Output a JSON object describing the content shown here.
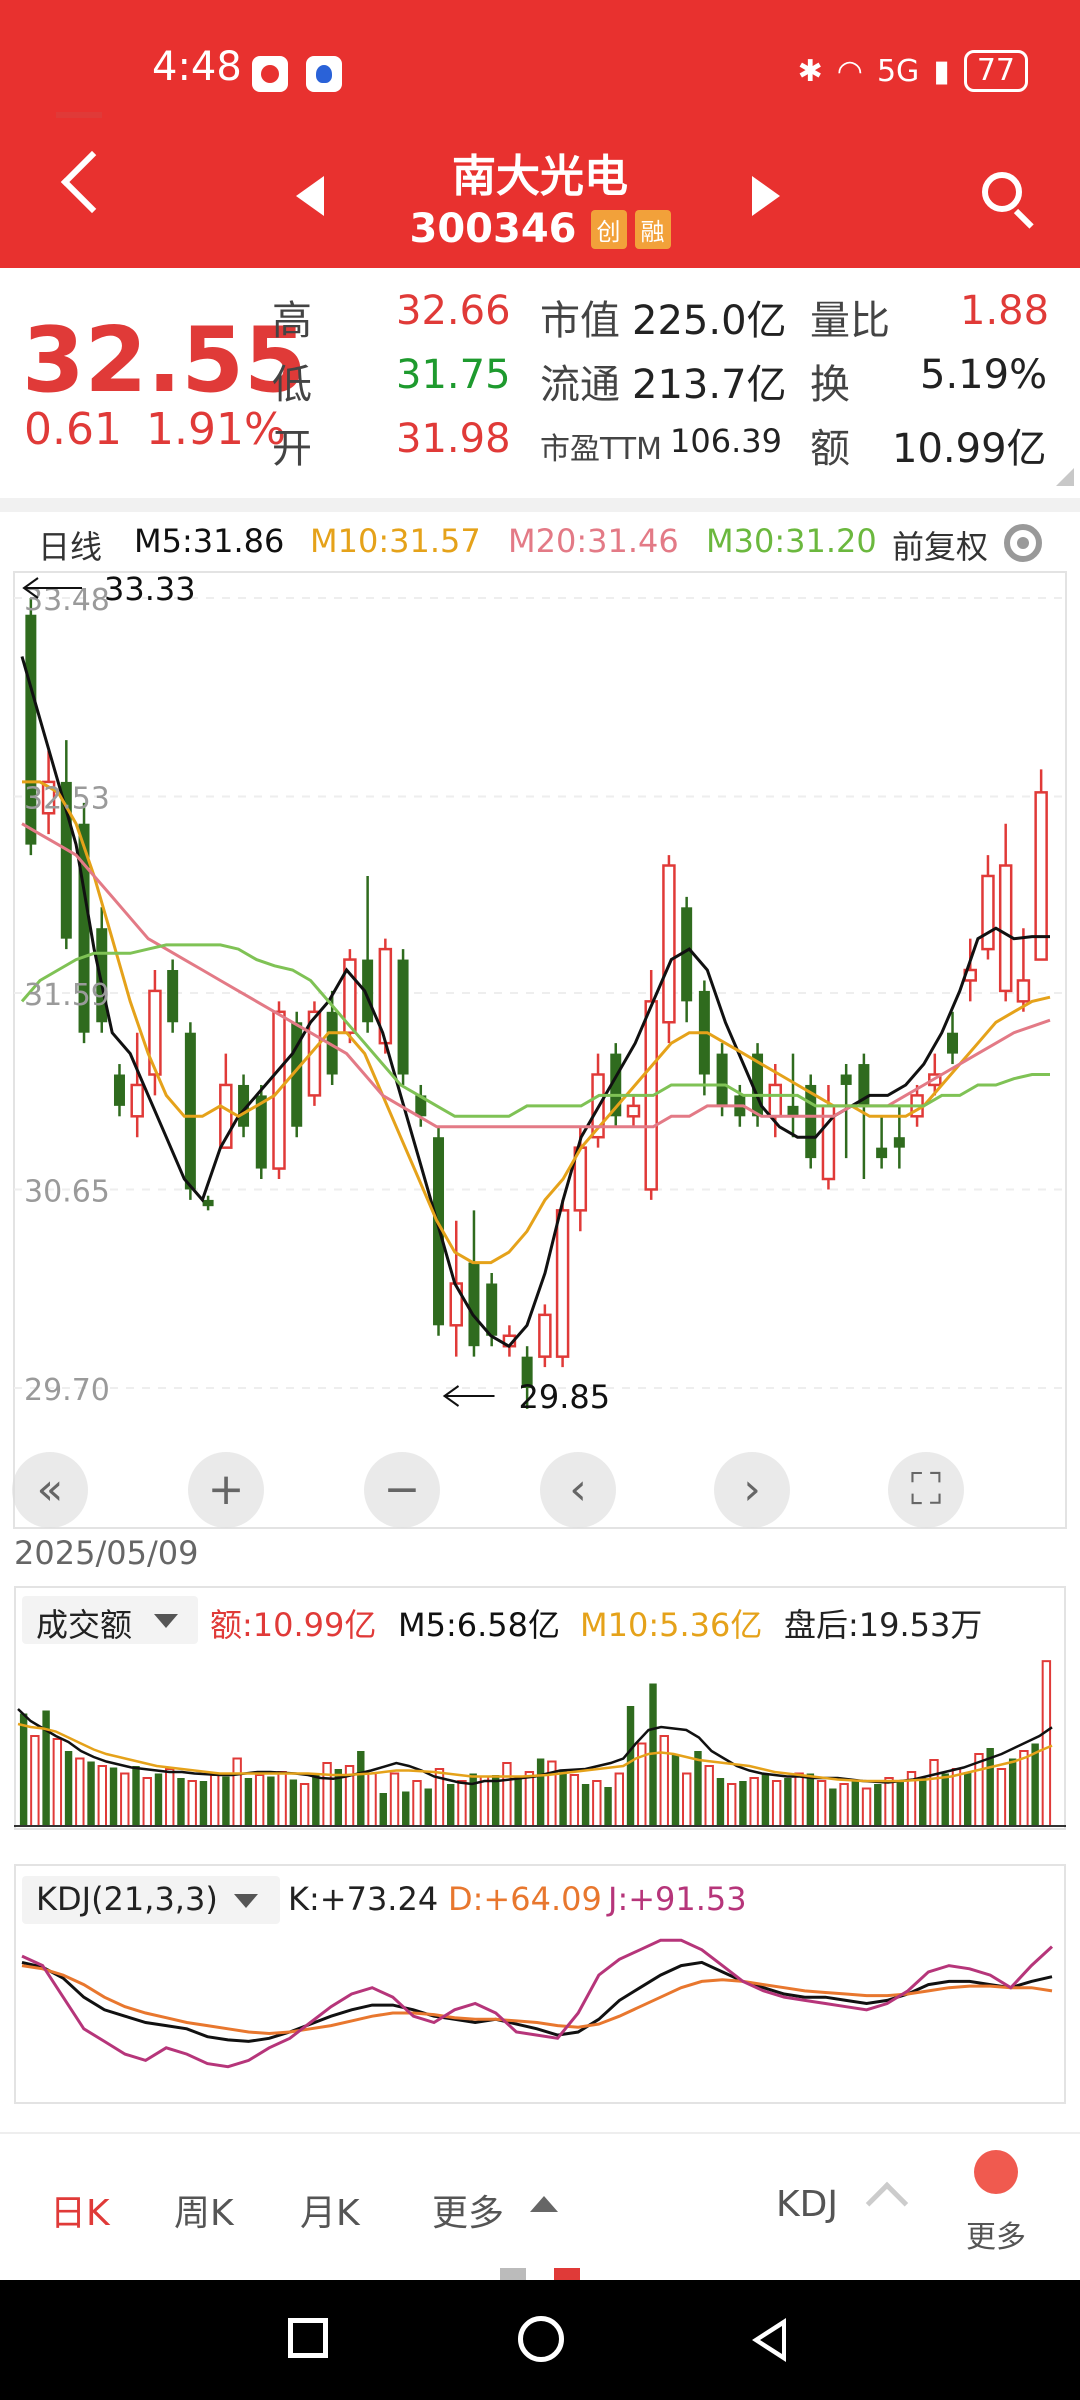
{
  "status_bar": {
    "time": "4:48",
    "signal": "5G",
    "battery": "77"
  },
  "header": {
    "title": "南大光电",
    "code": "300346",
    "tags": [
      "创",
      "融"
    ]
  },
  "quote": {
    "price": "32.55",
    "change": "0.61",
    "change_pct": "1.91%",
    "high_label": "高",
    "high": "32.66",
    "low_label": "低",
    "low": "31.75",
    "open_label": "开",
    "open": "31.98",
    "mcap_label": "市值",
    "mcap": "225.0亿",
    "float_label": "流通",
    "float": "213.7亿",
    "pe_label": "市盈TTM",
    "pe": "106.39",
    "vol_ratio_label": "量比",
    "vol_ratio": "1.88",
    "turnover_label": "换",
    "turnover": "5.19%",
    "amount_label": "额",
    "amount": "10.99亿"
  },
  "ma_legend": {
    "period": "日线",
    "m5": "M5:31.86",
    "m10": "M10:31.57",
    "m20": "M20:31.46",
    "m30": "M30:31.20",
    "adjust": "前复权"
  },
  "colors": {
    "up": "#e03a38",
    "down": "#2f6b1e",
    "m5": "#111111",
    "m10": "#e5a21a",
    "m20": "#e37a86",
    "m30": "#7fc255",
    "header": "#e8312f"
  },
  "chart_data": [
    {
      "type": "candlestick",
      "title": "日线",
      "y_ticks": [
        "33.48",
        "32.53",
        "31.59",
        "30.65",
        "29.70"
      ],
      "ylim": [
        29.7,
        33.48
      ],
      "annotations": {
        "max": "33.33",
        "min": "29.85"
      },
      "first_date": "2025/05/09",
      "candles": [
        {
          "o": 33.4,
          "c": 32.3,
          "h": 33.48,
          "l": 32.25
        },
        {
          "o": 32.45,
          "c": 32.6,
          "h": 32.75,
          "l": 32.35
        },
        {
          "o": 32.6,
          "c": 31.85,
          "h": 32.8,
          "l": 31.8
        },
        {
          "o": 32.4,
          "c": 31.4,
          "h": 32.5,
          "l": 31.35
        },
        {
          "o": 31.9,
          "c": 31.45,
          "h": 32.0,
          "l": 31.4
        },
        {
          "o": 31.2,
          "c": 31.05,
          "h": 31.25,
          "l": 31.0
        },
        {
          "o": 31.0,
          "c": 31.15,
          "h": 31.4,
          "l": 30.9
        },
        {
          "o": 31.2,
          "c": 31.6,
          "h": 31.7,
          "l": 31.1
        },
        {
          "o": 31.7,
          "c": 31.45,
          "h": 31.75,
          "l": 31.4
        },
        {
          "o": 31.4,
          "c": 30.65,
          "h": 31.45,
          "l": 30.6
        },
        {
          "o": 30.6,
          "c": 30.57,
          "h": 30.62,
          "l": 30.55
        },
        {
          "o": 30.85,
          "c": 31.15,
          "h": 31.3,
          "l": 30.85
        },
        {
          "o": 31.15,
          "c": 30.95,
          "h": 31.2,
          "l": 30.9
        },
        {
          "o": 31.1,
          "c": 30.75,
          "h": 31.15,
          "l": 30.7
        },
        {
          "o": 30.75,
          "c": 31.5,
          "h": 31.55,
          "l": 30.7
        },
        {
          "o": 31.45,
          "c": 30.95,
          "h": 31.5,
          "l": 30.9
        },
        {
          "o": 31.1,
          "c": 31.5,
          "h": 31.55,
          "l": 31.05
        },
        {
          "o": 31.5,
          "c": 31.2,
          "h": 31.6,
          "l": 31.15
        },
        {
          "o": 31.4,
          "c": 31.75,
          "h": 31.8,
          "l": 31.35
        },
        {
          "o": 31.75,
          "c": 31.45,
          "h": 32.15,
          "l": 31.4
        },
        {
          "o": 31.35,
          "c": 31.8,
          "h": 31.85,
          "l": 31.3
        },
        {
          "o": 31.75,
          "c": 31.2,
          "h": 31.8,
          "l": 31.15
        },
        {
          "o": 31.1,
          "c": 31.0,
          "h": 31.15,
          "l": 30.95
        },
        {
          "o": 30.9,
          "c": 30.0,
          "h": 30.95,
          "l": 29.95
        },
        {
          "o": 30.0,
          "c": 30.2,
          "h": 30.5,
          "l": 29.85
        },
        {
          "o": 30.3,
          "c": 29.9,
          "h": 30.55,
          "l": 29.85
        },
        {
          "o": 30.2,
          "c": 29.95,
          "h": 30.25,
          "l": 29.9
        },
        {
          "o": 29.9,
          "c": 29.95,
          "h": 30.0,
          "l": 29.85
        },
        {
          "o": 29.85,
          "c": 29.7,
          "h": 29.9,
          "l": 29.6
        },
        {
          "o": 29.85,
          "c": 30.05,
          "h": 30.1,
          "l": 29.8
        },
        {
          "o": 29.85,
          "c": 30.55,
          "h": 30.6,
          "l": 29.8
        },
        {
          "o": 30.55,
          "c": 30.85,
          "h": 30.95,
          "l": 30.45
        },
        {
          "o": 30.9,
          "c": 31.2,
          "h": 31.3,
          "l": 30.85
        },
        {
          "o": 31.3,
          "c": 31.0,
          "h": 31.35,
          "l": 30.95
        },
        {
          "o": 31.0,
          "c": 31.05,
          "h": 31.1,
          "l": 30.95
        },
        {
          "o": 30.65,
          "c": 31.55,
          "h": 31.7,
          "l": 30.6
        },
        {
          "o": 31.45,
          "c": 32.2,
          "h": 32.25,
          "l": 31.35
        },
        {
          "o": 32.0,
          "c": 31.55,
          "h": 32.05,
          "l": 31.45
        },
        {
          "o": 31.6,
          "c": 31.2,
          "h": 31.65,
          "l": 31.1
        },
        {
          "o": 31.3,
          "c": 31.05,
          "h": 31.35,
          "l": 31.0
        },
        {
          "o": 31.1,
          "c": 31.0,
          "h": 31.15,
          "l": 30.95
        },
        {
          "o": 31.3,
          "c": 31.0,
          "h": 31.35,
          "l": 30.95
        },
        {
          "o": 31.0,
          "c": 31.15,
          "h": 31.25,
          "l": 30.9
        },
        {
          "o": 31.05,
          "c": 31.0,
          "h": 31.3,
          "l": 30.9
        },
        {
          "o": 31.15,
          "c": 30.8,
          "h": 31.2,
          "l": 30.75
        },
        {
          "o": 30.7,
          "c": 31.05,
          "h": 31.15,
          "l": 30.65
        },
        {
          "o": 31.2,
          "c": 31.15,
          "h": 31.25,
          "l": 30.8
        },
        {
          "o": 31.25,
          "c": 31.05,
          "h": 31.3,
          "l": 30.7
        },
        {
          "o": 30.85,
          "c": 30.8,
          "h": 31.0,
          "l": 30.75
        },
        {
          "o": 30.9,
          "c": 30.85,
          "h": 31.05,
          "l": 30.75
        },
        {
          "o": 31.0,
          "c": 31.1,
          "h": 31.15,
          "l": 30.95
        },
        {
          "o": 31.15,
          "c": 31.2,
          "h": 31.3,
          "l": 31.1
        },
        {
          "o": 31.4,
          "c": 31.3,
          "h": 31.5,
          "l": 31.25
        },
        {
          "o": 31.65,
          "c": 31.7,
          "h": 31.85,
          "l": 31.55
        },
        {
          "o": 31.8,
          "c": 32.15,
          "h": 32.25,
          "l": 31.75
        },
        {
          "o": 31.6,
          "c": 32.2,
          "h": 32.4,
          "l": 31.55
        },
        {
          "o": 31.55,
          "c": 31.65,
          "h": 31.9,
          "l": 31.5
        },
        {
          "o": 31.75,
          "c": 32.55,
          "h": 32.66,
          "l": 31.75
        }
      ],
      "series": [
        {
          "name": "M5",
          "values": [
            33.2,
            32.9,
            32.6,
            32.3,
            31.8,
            31.4,
            31.3,
            31.1,
            30.9,
            30.7,
            30.6,
            30.85,
            31.0,
            31.1,
            31.2,
            31.3,
            31.45,
            31.55,
            31.7,
            31.6,
            31.4,
            31.1,
            30.8,
            30.5,
            30.2,
            30.05,
            29.95,
            29.9,
            30.0,
            30.25,
            30.6,
            30.9,
            31.05,
            31.2,
            31.35,
            31.55,
            31.75,
            31.8,
            31.7,
            31.45,
            31.25,
            31.05,
            30.95,
            30.9,
            30.9,
            31.0,
            31.05,
            31.1,
            31.1,
            31.15,
            31.25,
            31.4,
            31.6,
            31.85,
            31.9,
            31.85,
            31.86,
            31.86
          ]
        },
        {
          "name": "M10",
          "values": [
            32.6,
            32.6,
            32.55,
            32.4,
            32.15,
            31.85,
            31.55,
            31.3,
            31.1,
            31.0,
            31.0,
            31.05,
            31.0,
            31.05,
            31.1,
            31.2,
            31.3,
            31.4,
            31.4,
            31.3,
            31.1,
            30.9,
            30.7,
            30.5,
            30.35,
            30.3,
            30.3,
            30.35,
            30.45,
            30.6,
            30.7,
            30.85,
            30.95,
            31.05,
            31.15,
            31.25,
            31.35,
            31.4,
            31.4,
            31.35,
            31.3,
            31.25,
            31.2,
            31.15,
            31.1,
            31.05,
            31.05,
            31.0,
            31.0,
            31.0,
            31.05,
            31.15,
            31.25,
            31.35,
            31.45,
            31.5,
            31.55,
            31.57
          ]
        },
        {
          "name": "M20",
          "values": [
            32.4,
            32.35,
            32.3,
            32.25,
            32.15,
            32.05,
            31.95,
            31.85,
            31.8,
            31.75,
            31.7,
            31.65,
            31.6,
            31.55,
            31.5,
            31.45,
            31.4,
            31.35,
            31.3,
            31.2,
            31.1,
            31.05,
            31.0,
            30.95,
            30.95,
            30.95,
            30.95,
            30.95,
            30.95,
            30.95,
            30.95,
            30.95,
            30.95,
            30.95,
            30.95,
            30.95,
            31.0,
            31.0,
            31.05,
            31.05,
            31.05,
            31.0,
            31.0,
            31.0,
            31.0,
            31.0,
            31.05,
            31.05,
            31.05,
            31.1,
            31.15,
            31.2,
            31.25,
            31.3,
            31.35,
            31.4,
            31.43,
            31.46
          ]
        },
        {
          "name": "M30",
          "values": [
            31.55,
            31.65,
            31.7,
            31.75,
            31.78,
            31.78,
            31.78,
            31.8,
            31.82,
            31.82,
            31.82,
            31.82,
            31.8,
            31.75,
            31.72,
            31.7,
            31.65,
            31.55,
            31.45,
            31.35,
            31.25,
            31.15,
            31.1,
            31.05,
            31.0,
            31.0,
            31.0,
            31.0,
            31.05,
            31.05,
            31.05,
            31.05,
            31.1,
            31.1,
            31.1,
            31.1,
            31.15,
            31.15,
            31.15,
            31.15,
            31.1,
            31.1,
            31.1,
            31.1,
            31.05,
            31.05,
            31.05,
            31.05,
            31.05,
            31.05,
            31.05,
            31.1,
            31.1,
            31.15,
            31.15,
            31.18,
            31.2,
            31.2
          ]
        }
      ]
    },
    {
      "type": "bar",
      "title": "成交额",
      "labels": {
        "amount": "额:10.99亿",
        "m5": "M5:6.58亿",
        "m10": "M10:5.36亿",
        "after_hours": "盘后:19.53万"
      },
      "values": [
        7.5,
        6.0,
        7.7,
        5.8,
        5.0,
        4.5,
        4.3,
        4.0,
        3.9,
        3.5,
        4.0,
        3.2,
        3.5,
        3.8,
        3.2,
        3.0,
        3.0,
        3.4,
        3.3,
        4.5,
        3.2,
        3.4,
        3.3,
        3.6,
        3.1,
        2.8,
        3.4,
        4.2,
        3.8,
        4.0,
        5.0,
        3.5,
        2.2,
        3.5,
        2.3,
        3.0,
        2.5,
        3.8,
        2.8,
        3.0,
        3.5,
        3.3,
        3.4,
        4.2,
        3.3,
        3.6,
        4.5,
        4.3,
        3.7,
        3.4,
        2.8,
        3.0,
        2.6,
        3.5,
        8.0,
        5.5,
        9.5,
        6.0,
        4.8,
        3.5,
        5.0,
        4.0,
        3.2,
        2.8,
        3.0,
        3.2,
        3.5,
        3.0,
        3.2,
        3.5,
        3.5,
        3.0,
        2.5,
        2.8,
        3.0,
        2.5,
        2.8,
        3.2,
        3.0,
        3.6,
        3.2,
        4.4,
        3.5,
        3.8,
        3.6,
        4.8,
        5.2,
        3.8,
        4.5,
        5.0,
        5.5,
        10.99
      ],
      "series": [
        {
          "name": "M5",
          "values": [
            7.8,
            7.0,
            6.5,
            6.0,
            5.6,
            5.0,
            4.6,
            4.3,
            4.1,
            3.9,
            3.8,
            3.7,
            3.6,
            3.6,
            3.5,
            3.45,
            3.4,
            3.4,
            3.5,
            3.6,
            3.6,
            3.55,
            3.5,
            3.4,
            3.2,
            3.15,
            3.3,
            3.5,
            3.7,
            3.95,
            4.2,
            4.0,
            3.7,
            3.3,
            3.1,
            2.9,
            2.8,
            3.0,
            3.0,
            3.1,
            3.2,
            3.3,
            3.5,
            3.7,
            3.75,
            3.8,
            4.0,
            4.2,
            4.5,
            5.5,
            6.4,
            6.6,
            6.5,
            6.4,
            5.9,
            5.0,
            4.5,
            4.0,
            3.7,
            3.5,
            3.4,
            3.3,
            3.3,
            3.2,
            3.2,
            3.2,
            3.1,
            3.0,
            2.95,
            2.9,
            3.0,
            3.1,
            3.3,
            3.5,
            3.7,
            3.9,
            4.2,
            4.5,
            4.8,
            5.2,
            5.6,
            6.0,
            6.58
          ]
        },
        {
          "name": "M10",
          "values": [
            6.8,
            6.6,
            6.5,
            6.3,
            5.9,
            5.5,
            5.1,
            4.8,
            4.6,
            4.4,
            4.2,
            4.0,
            3.9,
            3.8,
            3.7,
            3.6,
            3.5,
            3.5,
            3.5,
            3.5,
            3.5,
            3.5,
            3.5,
            3.5,
            3.45,
            3.4,
            3.4,
            3.45,
            3.5,
            3.6,
            3.7,
            3.7,
            3.65,
            3.6,
            3.5,
            3.4,
            3.3,
            3.3,
            3.3,
            3.3,
            3.3,
            3.35,
            3.4,
            3.5,
            3.6,
            3.7,
            3.8,
            3.9,
            4.0,
            4.5,
            4.8,
            4.9,
            4.8,
            4.6,
            4.4,
            4.3,
            4.2,
            4.1,
            4.0,
            3.8,
            3.6,
            3.5,
            3.4,
            3.3,
            3.2,
            3.1,
            3.05,
            3.0,
            3.0,
            3.0,
            3.0,
            3.05,
            3.1,
            3.2,
            3.3,
            3.5,
            3.7,
            3.9,
            4.1,
            4.3,
            4.6,
            5.0,
            5.36
          ]
        }
      ]
    },
    {
      "type": "line",
      "title": "KDJ(21,3,3)",
      "labels": {
        "k": "K:+73.24",
        "d": "D:+64.09",
        "j": "J:+91.53"
      },
      "ylim": [
        0,
        100
      ],
      "series": [
        {
          "name": "K",
          "values": [
            82,
            79,
            72,
            60,
            52,
            48,
            44,
            42,
            40,
            35,
            33,
            32,
            34,
            38,
            43,
            48,
            52,
            55,
            55,
            52,
            48,
            46,
            44,
            46,
            43,
            40,
            36,
            38,
            46,
            58,
            66,
            74,
            80,
            82,
            76,
            70,
            66,
            62,
            60,
            60,
            58,
            56,
            58,
            62,
            68,
            70,
            70,
            68,
            66,
            70,
            73
          ]
        },
        {
          "name": "D",
          "values": [
            80,
            78,
            74,
            68,
            60,
            54,
            50,
            47,
            44,
            42,
            40,
            38,
            37,
            38,
            40,
            42,
            45,
            48,
            50,
            50,
            49,
            47,
            46,
            46,
            45,
            44,
            42,
            41,
            43,
            48,
            54,
            60,
            66,
            70,
            71,
            70,
            68,
            66,
            64,
            63,
            62,
            61,
            61,
            62,
            64,
            66,
            67,
            67,
            66,
            66,
            64
          ]
        },
        {
          "name": "J",
          "values": [
            86,
            80,
            60,
            40,
            32,
            24,
            20,
            28,
            24,
            18,
            16,
            20,
            28,
            34,
            44,
            54,
            62,
            66,
            60,
            48,
            44,
            52,
            56,
            50,
            38,
            36,
            34,
            50,
            74,
            84,
            90,
            96,
            96,
            90,
            80,
            70,
            64,
            60,
            58,
            56,
            54,
            52,
            56,
            64,
            76,
            80,
            78,
            74,
            66,
            80,
            92
          ]
        }
      ]
    }
  ],
  "chart_controls": {
    "bottom_date": "2025/05/09"
  },
  "volume": {
    "selector": "成交额"
  },
  "kdj": {
    "selector": "KDJ(21,3,3)"
  },
  "tabs": {
    "day": "日K",
    "week": "周K",
    "month": "月K",
    "more": "更多",
    "indicator": "KDJ",
    "more2": "更多"
  }
}
